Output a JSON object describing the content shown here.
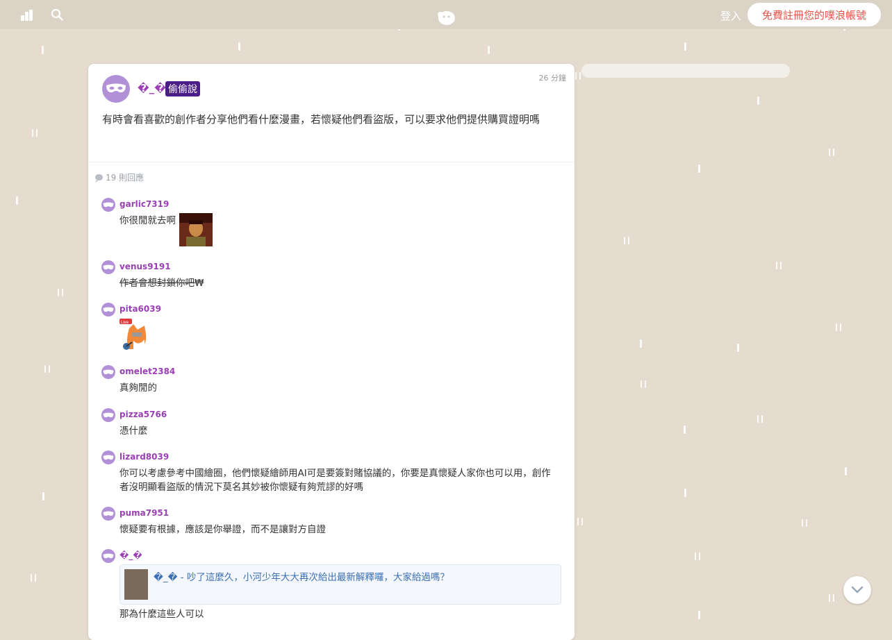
{
  "header": {
    "login_label": "登入",
    "signup_label": "免費註冊您的噗浪帳號",
    "signup_color": "#e8524a"
  },
  "post": {
    "author": "�_�",
    "badge": "偷偷說",
    "time": "26 分鐘",
    "text": "有時會看喜歡的創作者分享他們看什麼漫畫，若懷疑他們看盜版，可以要求他們提供購買證明嗎"
  },
  "replies": {
    "count_label": "19 則回應",
    "items": [
      {
        "user": "garlic7319",
        "text": "你很閒就去啊"
      },
      {
        "user": "venus9191",
        "text": "作者會想封鎖你吧₩"
      },
      {
        "user": "pita6039",
        "text": ""
      },
      {
        "user": "omelet2384",
        "text": "真夠閒的"
      },
      {
        "user": "pizza5766",
        "text": "憑什麼"
      },
      {
        "user": "lizard8039",
        "text": "你可以考慮參考中國繪圈，他們懷疑繪師用AI可是要簽對賭協議的，你要是真懷疑人家你也可以用，創作者沒明顯看盜版的情況下莫名其妙被你懷疑有夠荒謬的好嗎"
      },
      {
        "user": "puma7951",
        "text": "懷疑要有根據，應該是你舉證，而不是讓對方自證"
      },
      {
        "user": "�_�",
        "quote": "�_� - 吵了這麼久，小河少年大大再次給出最新解釋囉，大家給過嗎？",
        "text": "那為什麼這些人可以"
      }
    ]
  },
  "sticker": {
    "live_label": "Live"
  },
  "colors": {
    "background": "#e5dccf",
    "username": "#9b3fb5",
    "badge": "#4b1d8c"
  }
}
